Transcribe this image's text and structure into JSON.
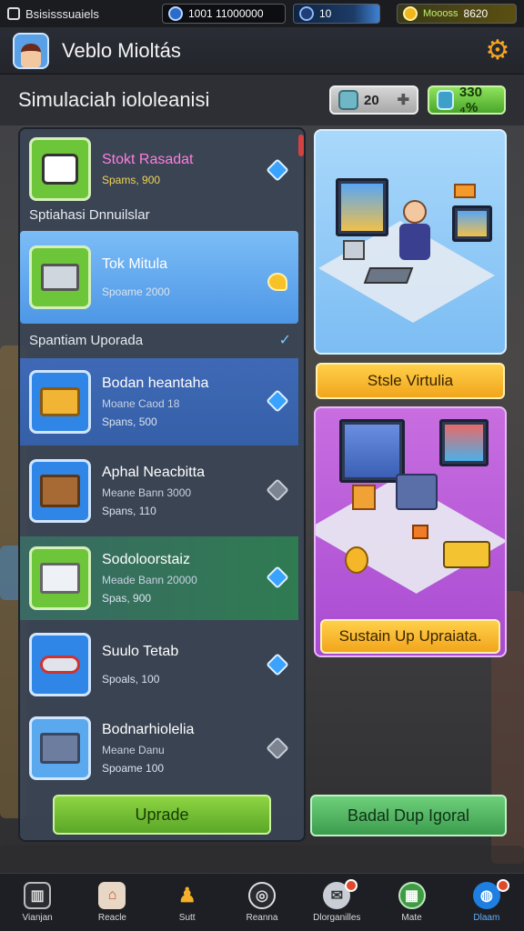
{
  "status_bar": {
    "left_label": "Bsisisssuaiels",
    "pill1_value": "1001   11000000",
    "pill2_value": "10",
    "pill3_label": "Moooss",
    "pill3_value": "8620"
  },
  "header": {
    "title": "Veblo Mioltás"
  },
  "subheader": {
    "title": "Simulaciah iololeanisi",
    "res1_value": "20",
    "res2_value": "330 ₄%"
  },
  "left_panel": {
    "top_item": {
      "name": "Stokt Rasadat",
      "cost": "Spams, 900"
    },
    "section1": "Sptiahasi Dnnuilslar",
    "selected_item": {
      "name": "Tok Mitula",
      "cost": "Spoame 2000"
    },
    "section2": "Spantiam Uporada",
    "items": [
      {
        "name": "Bodan heantaha",
        "sub": "Moane Caod 18",
        "cost": "Spans, 500"
      },
      {
        "name": "Aphal Neacbitta",
        "sub": "Meane Bann 3000",
        "cost": "Spans, 110"
      },
      {
        "name": "Sodoloorstaiz",
        "sub": "Meade Bann 20000",
        "cost": "Spas, 900"
      },
      {
        "name": "Suulo Tetab",
        "sub": "",
        "cost": "Spoals, 100"
      },
      {
        "name": "Bodnarhiolelia",
        "sub": "Meane Danu",
        "cost": "Spoame 100"
      }
    ],
    "upgrade_label": "Uprade"
  },
  "right": {
    "btn1_label": "Stsle Virtulia",
    "btn2_label": "Sustain Up Upraiata.",
    "btn3_label": "Badal Dup Igoral"
  },
  "bottom_nav": [
    {
      "label": "Vianjan",
      "icon": "trash-icon"
    },
    {
      "label": "Reacle",
      "icon": "shop-icon"
    },
    {
      "label": "Sutt",
      "icon": "figure-icon"
    },
    {
      "label": "Reanna",
      "icon": "target-icon"
    },
    {
      "label": "Dlorganilles",
      "icon": "chat-icon"
    },
    {
      "label": "Mate",
      "icon": "calendar-icon"
    },
    {
      "label": "Dlaam",
      "icon": "globe-icon"
    }
  ],
  "colors": {
    "accent_blue": "#4e97e6",
    "accent_green": "#5aa728",
    "accent_yellow": "#f1a51c",
    "accent_purple": "#a94bd2"
  }
}
